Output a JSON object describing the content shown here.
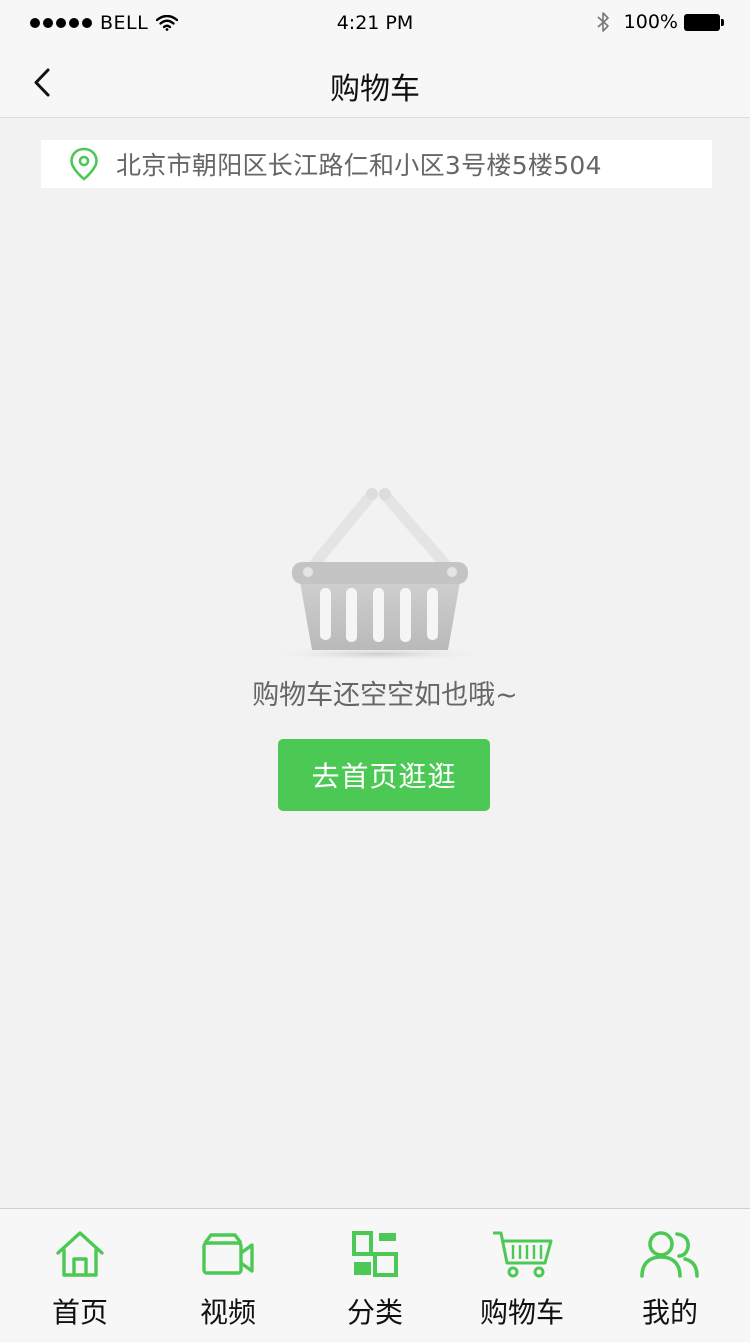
{
  "status_bar": {
    "carrier": "BELL",
    "time": "4:21 PM",
    "battery": "100%"
  },
  "nav": {
    "title": "购物车"
  },
  "address": {
    "text": "北京市朝阳区长江路仁和小区3号楼5楼504"
  },
  "empty": {
    "message": "购物车还空空如也哦~",
    "button_label": "去首页逛逛"
  },
  "tabs": [
    {
      "label": "首页",
      "icon": "home-icon"
    },
    {
      "label": "视频",
      "icon": "video-camera-icon"
    },
    {
      "label": "分类",
      "icon": "category-icon"
    },
    {
      "label": "购物车",
      "icon": "cart-icon"
    },
    {
      "label": "我的",
      "icon": "user-icon"
    }
  ],
  "colors": {
    "accent": "#4cc955",
    "background": "#f2f2f2",
    "muted_text": "#666666"
  }
}
